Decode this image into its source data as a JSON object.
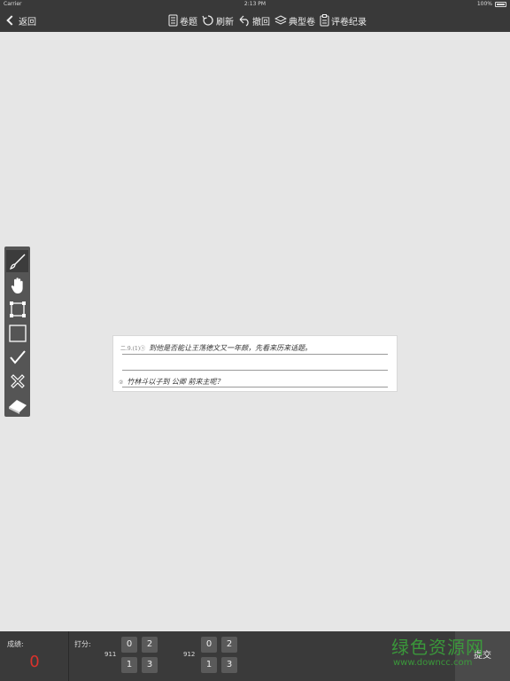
{
  "status_bar": {
    "carrier": "Carrier",
    "time": "2:13 PM",
    "battery": "100%"
  },
  "nav": {
    "back_label": "返回",
    "actions": [
      {
        "label": "卷题",
        "icon": "document-icon"
      },
      {
        "label": "刷新",
        "icon": "refresh-icon"
      },
      {
        "label": "撤回",
        "icon": "undo-icon"
      },
      {
        "label": "典型卷",
        "icon": "layers-icon"
      },
      {
        "label": "评卷纪录",
        "icon": "clipboard-icon"
      }
    ]
  },
  "paper": {
    "line1_num": "二.9.(1)①",
    "line1_text": "到他是否能让王荡德文又一年颇，先看来历来话题。",
    "line2_num": "②",
    "line2_text": "竹林斗以子到 公卿 前来主呢？"
  },
  "tools": [
    {
      "name": "brush-tool",
      "icon": "brush-icon",
      "active": true
    },
    {
      "name": "hand-tool",
      "icon": "hand-icon",
      "active": false
    },
    {
      "name": "crop-tool",
      "icon": "crop-icon",
      "active": false
    },
    {
      "name": "rectangle-tool",
      "icon": "rectangle-icon",
      "active": false
    },
    {
      "name": "check-tool",
      "icon": "check-icon",
      "active": false
    },
    {
      "name": "cross-tool",
      "icon": "cross-icon",
      "active": false
    },
    {
      "name": "eraser-tool",
      "icon": "eraser-icon",
      "active": false
    }
  ],
  "bottom": {
    "score_label": "成绩:",
    "score_value": "0",
    "grade_label": "打分:",
    "questions": [
      {
        "id": "911",
        "keys": [
          "0",
          "2",
          "1",
          "3"
        ]
      },
      {
        "id": "912",
        "keys": [
          "0",
          "2",
          "1",
          "3"
        ]
      }
    ],
    "submit_label": "提交"
  },
  "watermark": {
    "text": "绿色资源网",
    "url": "www.downcc.com"
  },
  "colors": {
    "bar": "#393939",
    "background": "#e6e6e6",
    "score": "#d9322c",
    "watermark": "#3aa83a"
  }
}
